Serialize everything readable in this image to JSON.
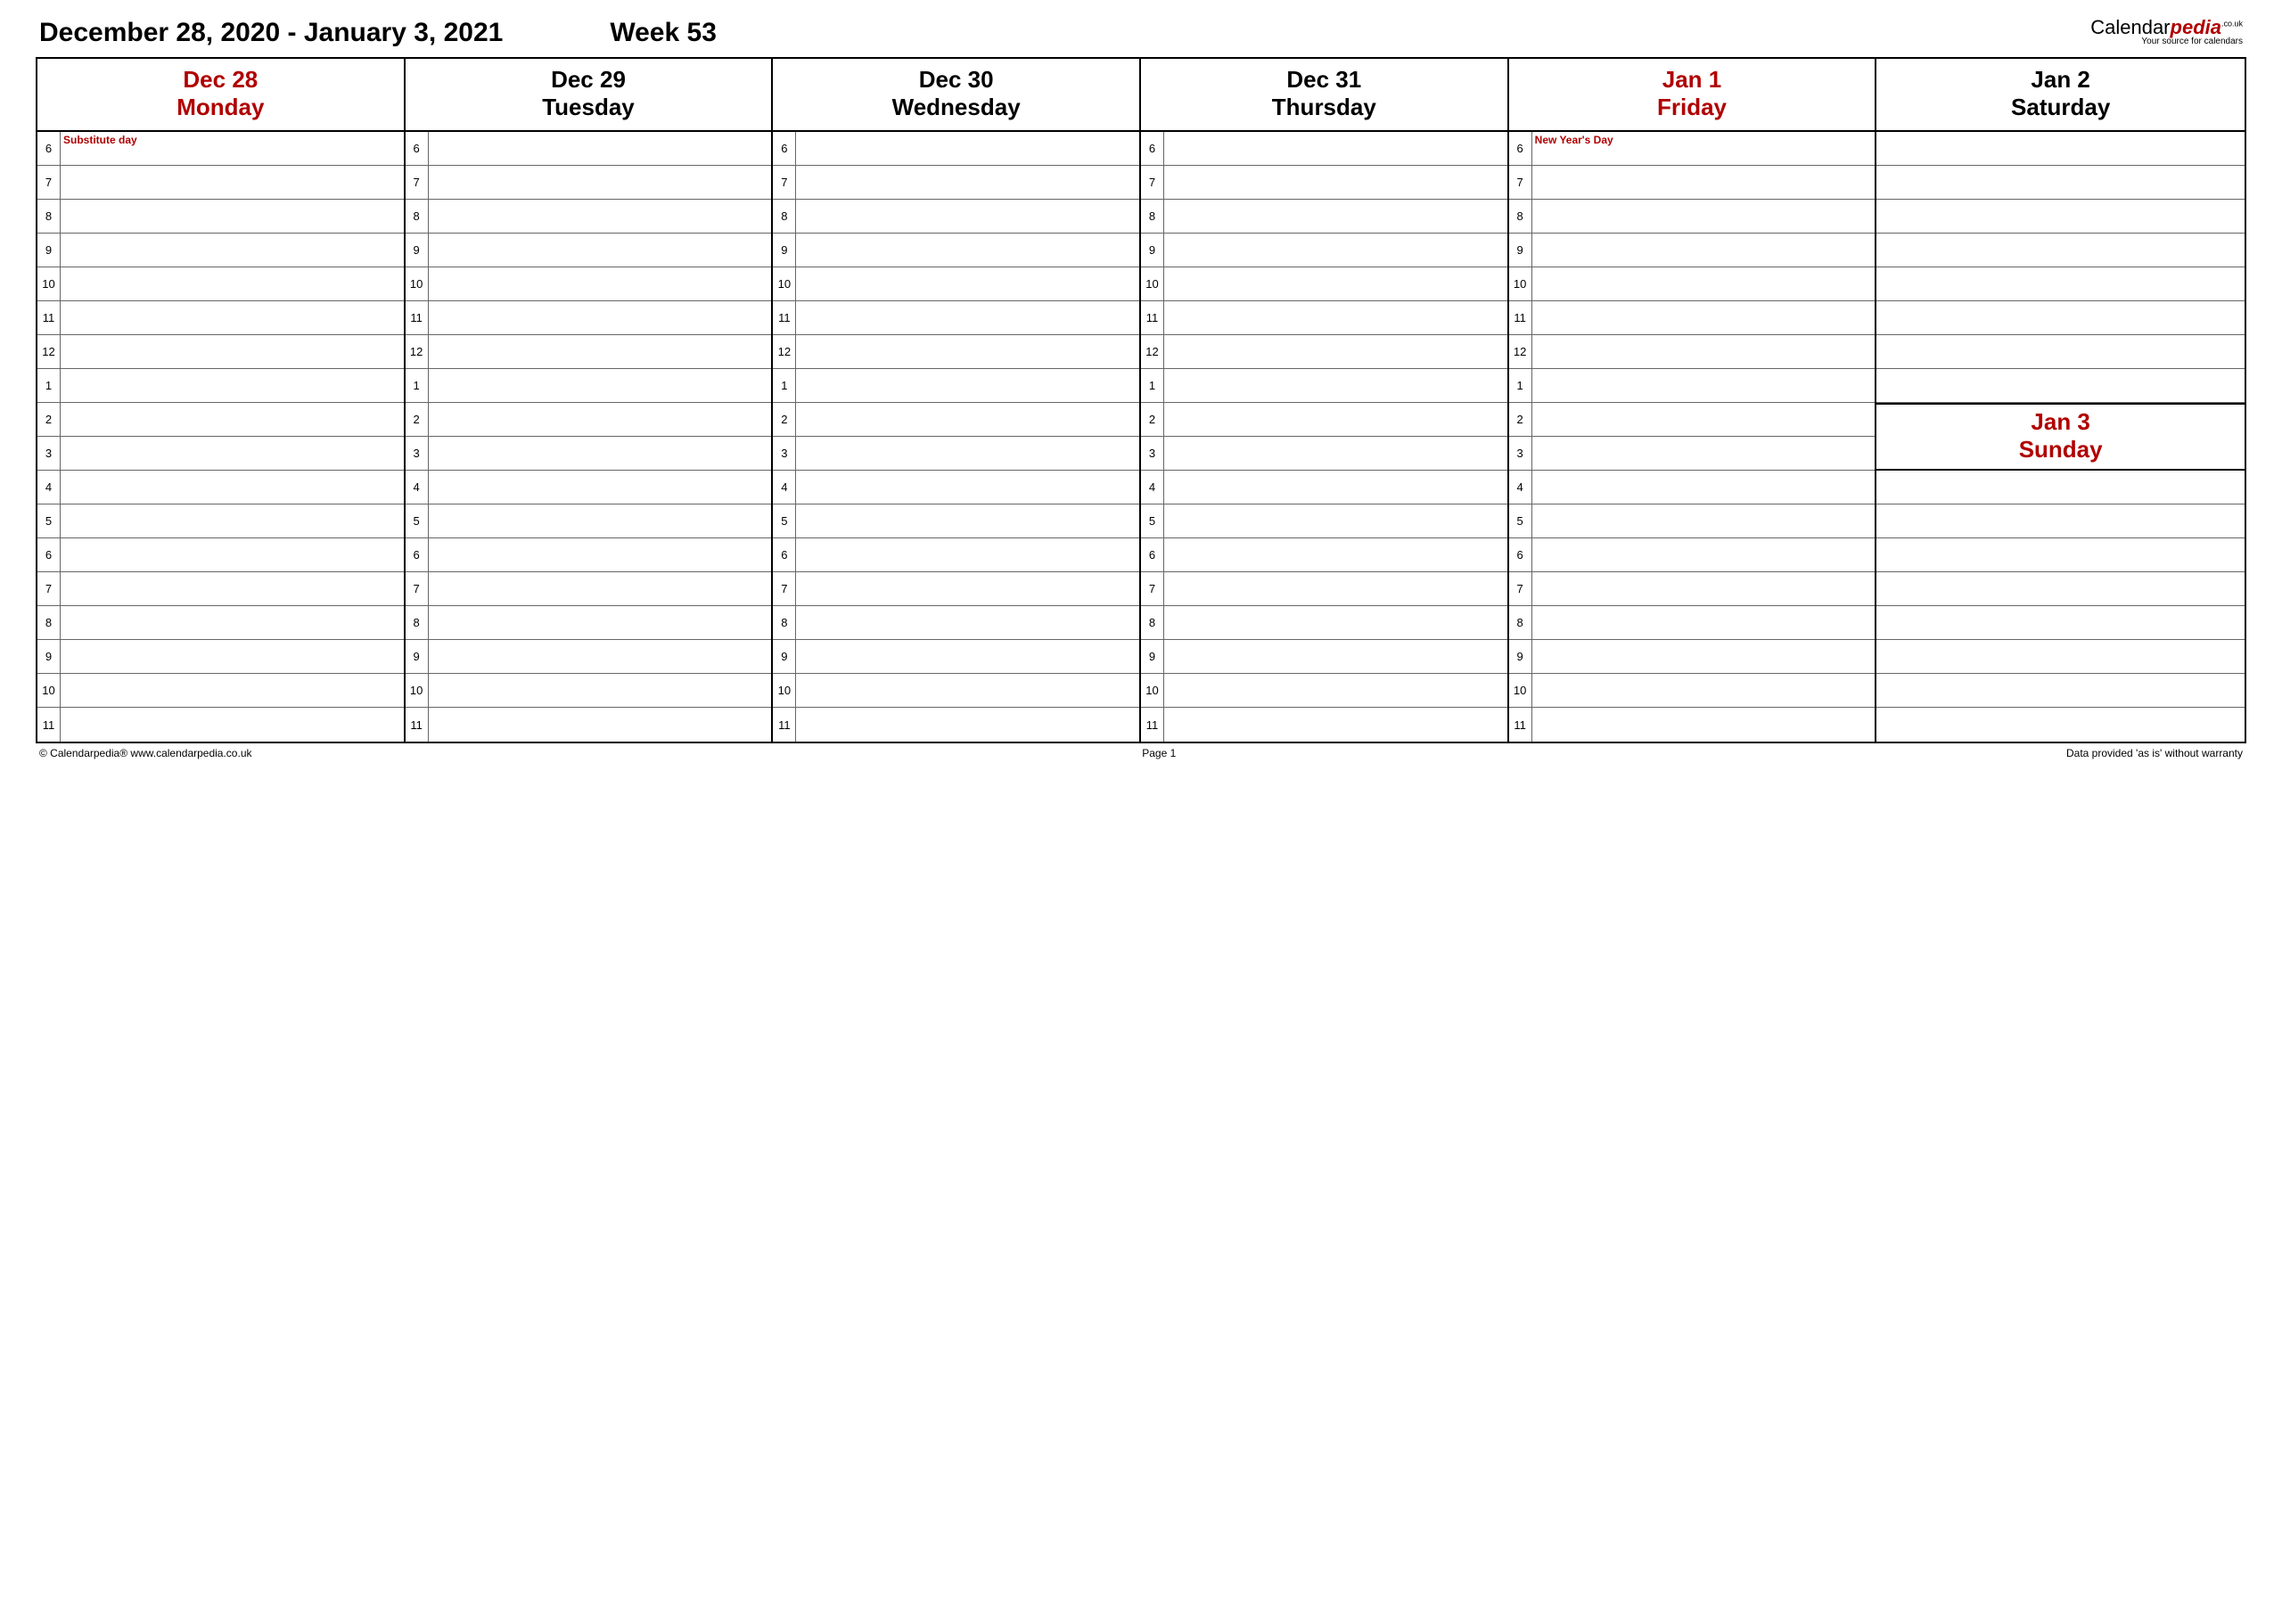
{
  "header": {
    "date_range": "December 28, 2020 - January 3, 2021",
    "week_label": "Week 53"
  },
  "logo": {
    "part1": "Calendar",
    "part2": "pedia",
    "tld": ".co.uk",
    "tagline": "Your source for calendars"
  },
  "hours": [
    "6",
    "7",
    "8",
    "9",
    "10",
    "11",
    "12",
    "1",
    "2",
    "3",
    "4",
    "5",
    "6",
    "7",
    "8",
    "9",
    "10",
    "11"
  ],
  "days": [
    {
      "date": "Dec 28",
      "name": "Monday",
      "highlight": true,
      "event": "Substitute day"
    },
    {
      "date": "Dec 29",
      "name": "Tuesday",
      "highlight": false,
      "event": ""
    },
    {
      "date": "Dec 30",
      "name": "Wednesday",
      "highlight": false,
      "event": ""
    },
    {
      "date": "Dec 31",
      "name": "Thursday",
      "highlight": false,
      "event": ""
    },
    {
      "date": "Jan 1",
      "name": "Friday",
      "highlight": true,
      "event": "New Year's Day"
    }
  ],
  "saturday": {
    "date": "Jan 2",
    "name": "Saturday",
    "highlight": false
  },
  "sunday": {
    "date": "Jan 3",
    "name": "Sunday",
    "highlight": true
  },
  "footer": {
    "left": "© Calendarpedia®   www.calendarpedia.co.uk",
    "center": "Page 1",
    "right": "Data provided 'as is' without warranty"
  }
}
